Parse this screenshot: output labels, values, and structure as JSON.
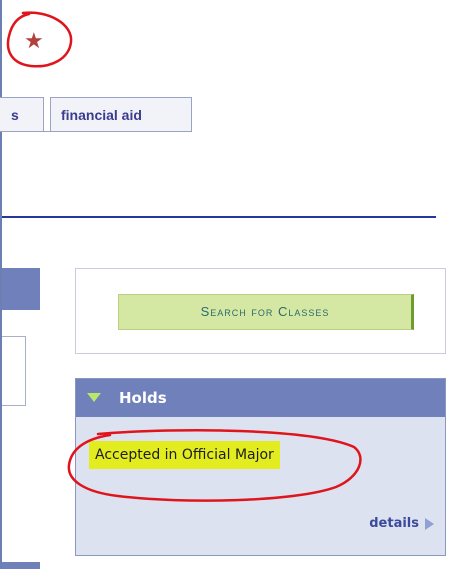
{
  "favorite": {
    "icon": "star-icon",
    "glyph": "★",
    "color": "#b2413d"
  },
  "tabs": [
    {
      "label": "s",
      "active": false
    },
    {
      "label": "financial aid",
      "active": false
    }
  ],
  "search": {
    "button_label": "Search for Classes"
  },
  "holds": {
    "title": "Holds",
    "items": [
      {
        "label": "Accepted in Official Major"
      }
    ],
    "details_label": "details"
  },
  "annotations": {
    "color": "#e0141b"
  },
  "colors": {
    "header": "#6f80ba",
    "panel_bg": "#dde2f0",
    "button_bg": "#d4e8a3",
    "highlight": "#e3ec1f",
    "divider": "#27369b"
  }
}
